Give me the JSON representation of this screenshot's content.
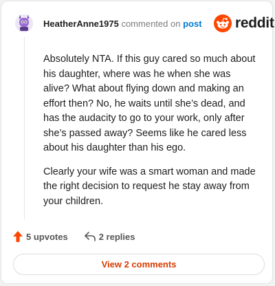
{
  "header": {
    "username": "HeatherAnne1975",
    "commented_on": "commented on",
    "post_link": "post",
    "brand": "reddit"
  },
  "comment": {
    "paragraphs": [
      "Absolutely NTA. If this guy cared so much about his daughter, where was he when she was alive? What about flying down and making an effort then? No, he waits until she’s dead, and has the audacity to go to your work, only after she’s passed away? Seems like he cared less about his daughter than his ego.",
      "Clearly your wife was a smart woman and made the right decision to request he stay away from your children."
    ]
  },
  "actions": {
    "upvotes": "5 upvotes",
    "replies": "2 replies"
  },
  "view_comments_label": "View 2 comments",
  "colors": {
    "brand_orange": "#ff4500",
    "link_blue": "#0079d3",
    "button_text": "#d93a00"
  }
}
